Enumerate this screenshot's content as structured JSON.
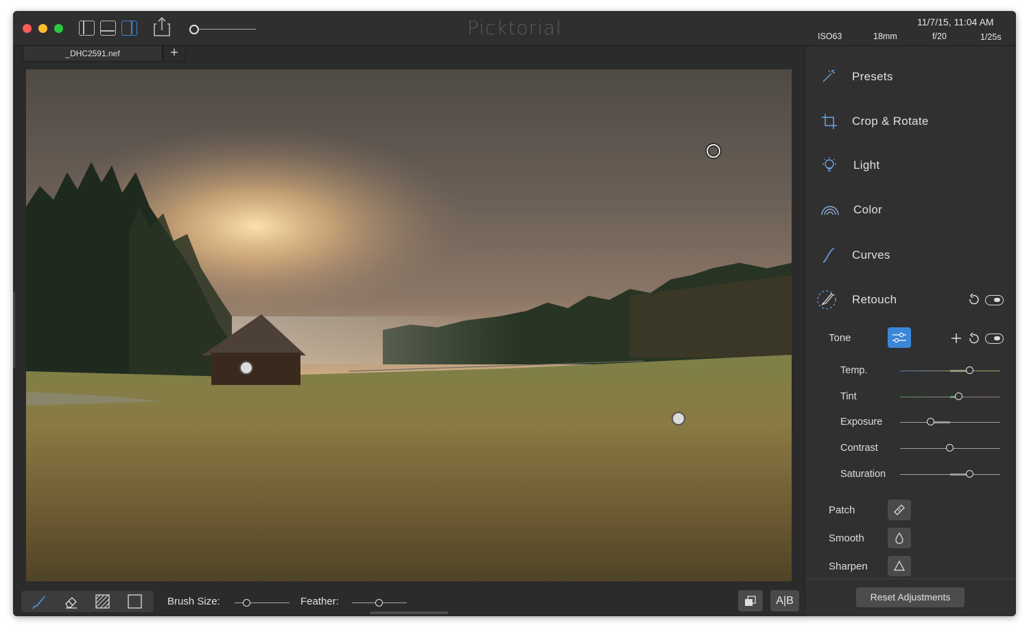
{
  "window": {
    "title": "Picktorial",
    "lights": {
      "close": "#fd5b57",
      "minimize": "#febc2e",
      "maximize": "#29c840"
    }
  },
  "toolbar": {
    "icons": [
      "sidebar-left-icon",
      "bottom-panel-icon",
      "sidebar-right-icon",
      "share-icon"
    ],
    "zoom_level": 0.05
  },
  "exif": {
    "datetime": "11/7/15, 11:04 AM",
    "iso": "ISO63",
    "focal": "18mm",
    "aperture": "f/20",
    "shutter": "1/25s"
  },
  "tabs": [
    {
      "label": "_DHC2591.nef"
    }
  ],
  "add_tab_label": "+",
  "sidebar": {
    "sections": [
      {
        "label": "Presets",
        "icon": "magic-wand-icon"
      },
      {
        "label": "Crop & Rotate",
        "icon": "crop-icon"
      },
      {
        "label": "Light",
        "icon": "lightbulb-icon"
      },
      {
        "label": "Color",
        "icon": "rainbow-icon"
      },
      {
        "label": "Curves",
        "icon": "curve-icon"
      },
      {
        "label": "Retouch",
        "icon": "brush-icon"
      }
    ],
    "tone": {
      "label": "Tone",
      "sliders": [
        {
          "label": "Temp.",
          "value": 0.7
        },
        {
          "label": "Tint",
          "value": 0.59
        },
        {
          "label": "Exposure",
          "value": 0.31
        },
        {
          "label": "Contrast",
          "value": 0.5
        },
        {
          "label": "Saturation",
          "value": 0.7
        }
      ]
    },
    "tools": [
      {
        "label": "Patch",
        "icon": "bandage-icon"
      },
      {
        "label": "Smooth",
        "icon": "drop-icon"
      },
      {
        "label": "Sharpen",
        "icon": "triangle-icon"
      }
    ],
    "reset_label": "Reset Adjustments"
  },
  "bottom": {
    "tools": [
      "brush-icon",
      "eraser-icon",
      "pattern-fill-icon",
      "square-icon"
    ],
    "brush_size_label": "Brush Size:",
    "brush_size_value": 0.22,
    "feather_label": "Feather:",
    "feather_value": 0.5,
    "ab_label": "A|B",
    "ab_icon": "compare-icon"
  },
  "accent": "#3b87d8"
}
